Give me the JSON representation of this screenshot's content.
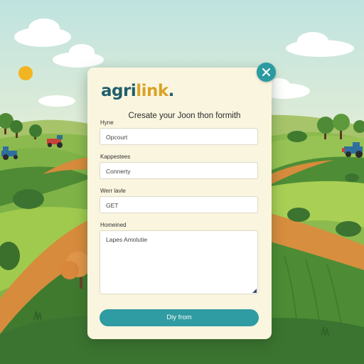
{
  "app": {
    "logo_main": "agri",
    "logo_accent": "link",
    "logo_dot": "."
  },
  "form": {
    "title": "Cresate your Joon thon formith",
    "fields": [
      {
        "label": "Hyne",
        "value": "Opcourt"
      },
      {
        "label": "Kappestees",
        "value": "Connerty"
      },
      {
        "label": "Werr lavle",
        "value": "GET"
      }
    ],
    "textarea": {
      "label": "Homeined",
      "value": "Lapes Amolutie"
    },
    "submit_label": "Diy from"
  },
  "icons": {
    "close": "close-icon",
    "resize": "resize-grip-icon"
  },
  "colors": {
    "accent": "#2f9ba2",
    "logo_dark": "#1f5f6a",
    "logo_accent": "#d9a329",
    "panel_bg": "#faf5df"
  }
}
